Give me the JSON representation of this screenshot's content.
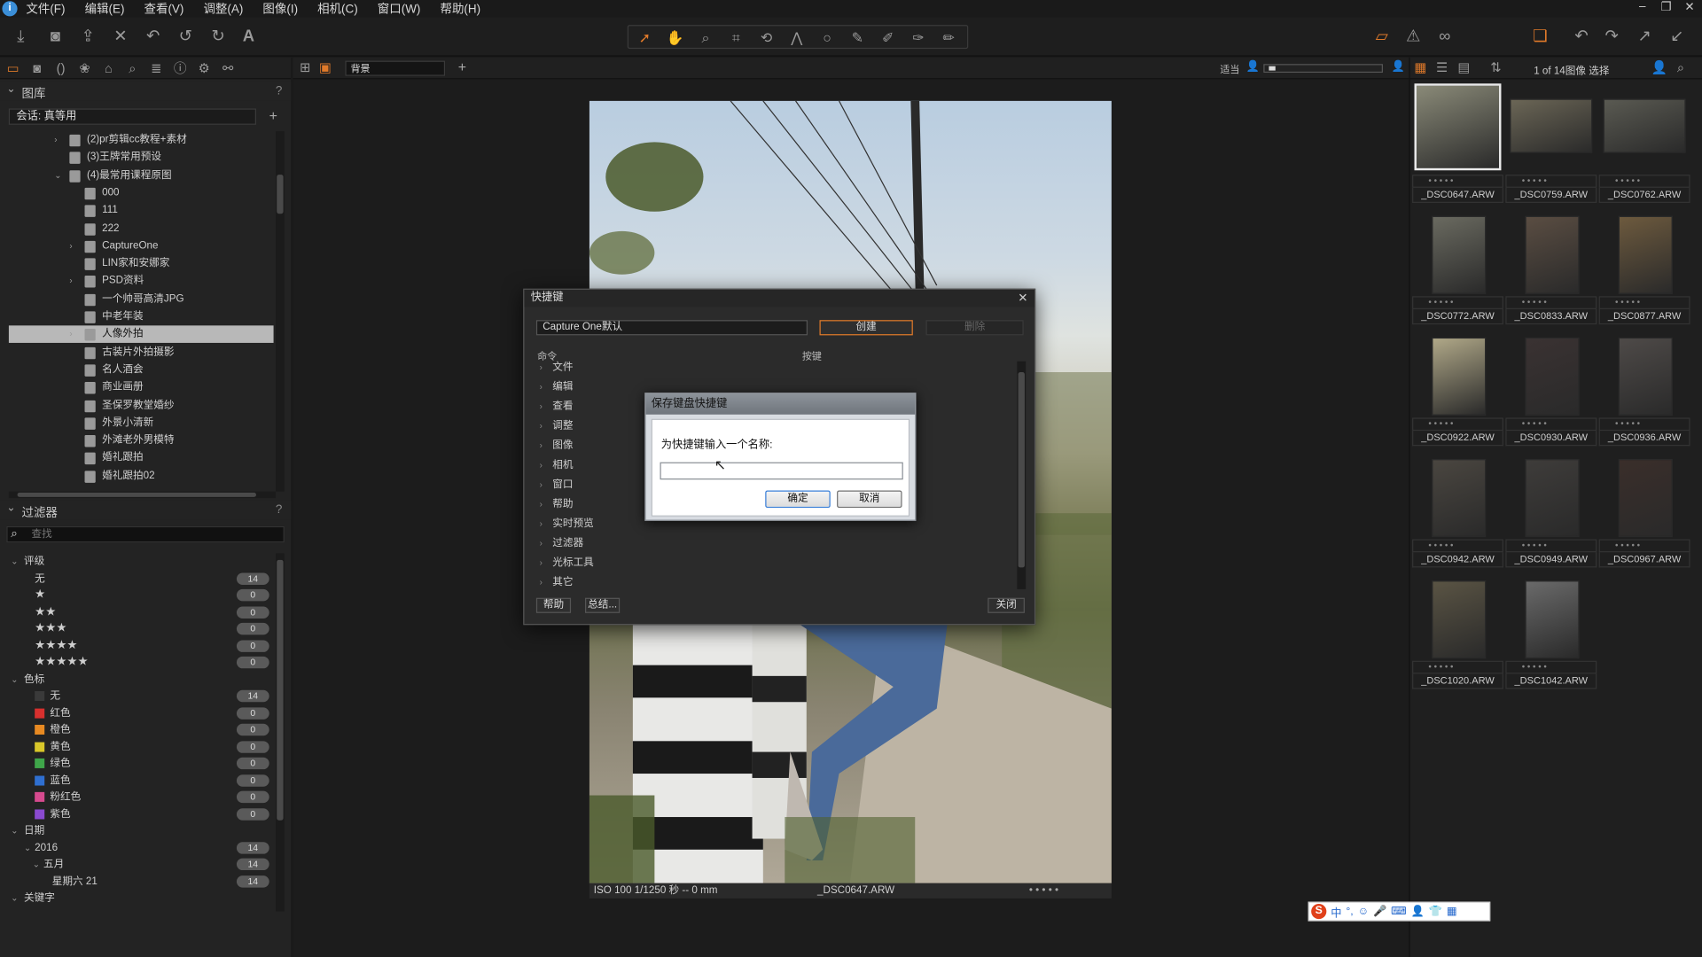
{
  "menu": {
    "items": [
      "文件(F)",
      "编辑(E)",
      "查看(V)",
      "调整(A)",
      "图像(I)",
      "相机(C)",
      "窗口(W)",
      "帮助(H)"
    ]
  },
  "library": {
    "title": "图库",
    "help": "?",
    "catalog": "会话: 真等用",
    "folders": [
      {
        "label": "(2)pr剪辑cc教程+素材",
        "indent": 1,
        "arrow": "›"
      },
      {
        "label": "(3)王牌常用预设",
        "indent": 1,
        "arrow": ""
      },
      {
        "label": "(4)最常用课程原图",
        "indent": 1,
        "arrow": "⌄"
      },
      {
        "label": "000",
        "indent": 2,
        "arrow": ""
      },
      {
        "label": "111",
        "indent": 2,
        "arrow": ""
      },
      {
        "label": "222",
        "indent": 2,
        "arrow": ""
      },
      {
        "label": "CaptureOne",
        "indent": 2,
        "arrow": "›"
      },
      {
        "label": "LIN家和安娜家",
        "indent": 2,
        "arrow": ""
      },
      {
        "label": "PSD资料",
        "indent": 2,
        "arrow": "›"
      },
      {
        "label": "一个帅哥高清JPG",
        "indent": 2,
        "arrow": ""
      },
      {
        "label": "中老年装",
        "indent": 2,
        "arrow": ""
      },
      {
        "label": "人像外拍",
        "indent": 2,
        "arrow": "›",
        "selected": true
      },
      {
        "label": "古装片外拍摄影",
        "indent": 2,
        "arrow": ""
      },
      {
        "label": "名人酒会",
        "indent": 2,
        "arrow": ""
      },
      {
        "label": "商业画册",
        "indent": 2,
        "arrow": ""
      },
      {
        "label": "圣保罗教堂婚纱",
        "indent": 2,
        "arrow": ""
      },
      {
        "label": "外景小清新",
        "indent": 2,
        "arrow": ""
      },
      {
        "label": "外滩老外男模特",
        "indent": 2,
        "arrow": ""
      },
      {
        "label": "婚礼跟拍",
        "indent": 2,
        "arrow": ""
      },
      {
        "label": "婚礼跟拍02",
        "indent": 2,
        "arrow": ""
      }
    ]
  },
  "filters": {
    "title": "过滤器",
    "help": "?",
    "search_placeholder": "查找",
    "rating_title": "评级",
    "ratings": [
      {
        "label": "无",
        "count": "14"
      },
      {
        "label": "★",
        "count": "0"
      },
      {
        "label": "★★",
        "count": "0"
      },
      {
        "label": "★★★",
        "count": "0"
      },
      {
        "label": "★★★★",
        "count": "0"
      },
      {
        "label": "★★★★★",
        "count": "0"
      }
    ],
    "color_title": "色标",
    "colors": [
      {
        "label": "无",
        "count": "14",
        "color": "#3a3a3a"
      },
      {
        "label": "红色",
        "count": "0",
        "color": "#d8302e"
      },
      {
        "label": "橙色",
        "count": "0",
        "color": "#e88a22"
      },
      {
        "label": "黄色",
        "count": "0",
        "color": "#d9c72a"
      },
      {
        "label": "绿色",
        "count": "0",
        "color": "#3fa64a"
      },
      {
        "label": "蓝色",
        "count": "0",
        "color": "#2f6fd0"
      },
      {
        "label": "粉红色",
        "count": "0",
        "color": "#d64a8e"
      },
      {
        "label": "紫色",
        "count": "0",
        "color": "#8a4ad0"
      }
    ],
    "date_title": "日期",
    "dates": [
      {
        "label": "2016",
        "count": "14"
      },
      {
        "label": "五月",
        "count": "14"
      },
      {
        "label": "星期六 21",
        "count": "14"
      }
    ],
    "keyword_title": "关键字"
  },
  "viewer": {
    "layer": "背景",
    "exposure_label": "适当",
    "photo_info": "ISO 100  1/1250 秒  -- 0 mm",
    "photo_name": "_DSC0647.ARW",
    "photo_dots": "• • • • •"
  },
  "browser": {
    "count": "1 of 14图像 选择",
    "thumbs": [
      {
        "name": "_DSC0647.ARW",
        "selected": true,
        "tone": "#8a8a78"
      },
      {
        "name": "_DSC0759.ARW",
        "tone": "#6b6656"
      },
      {
        "name": "_DSC0762.ARW",
        "tone": "#5a5a52"
      },
      {
        "name": "_DSC0772.ARW",
        "tone": "#6a6a60"
      },
      {
        "name": "_DSC0833.ARW",
        "tone": "#5a4d42"
      },
      {
        "name": "_DSC0877.ARW",
        "tone": "#6d5a3e"
      },
      {
        "name": "_DSC0922.ARW",
        "tone": "#b0a888"
      },
      {
        "name": "_DSC0930.ARW",
        "tone": "#3a3232"
      },
      {
        "name": "_DSC0936.ARW",
        "tone": "#4e4a48"
      },
      {
        "name": "_DSC0942.ARW",
        "tone": "#4a4640"
      },
      {
        "name": "_DSC0949.ARW",
        "tone": "#3e3c3a"
      },
      {
        "name": "_DSC0967.ARW",
        "tone": "#3a2e2a"
      },
      {
        "name": "_DSC1020.ARW",
        "tone": "#5a5444"
      },
      {
        "name": "_DSC1042.ARW",
        "tone": "#6a6a6a"
      }
    ]
  },
  "shortcut_dialog": {
    "title": "快捷键",
    "preset": "Capture One默认",
    "create": "创建",
    "delete": "删除",
    "col_command": "命令",
    "col_key": "按键",
    "commands": [
      "文件",
      "编辑",
      "查看",
      "调整",
      "图像",
      "相机",
      "窗口",
      "帮助",
      "实时预览",
      "过滤器",
      "光标工具",
      "其它"
    ],
    "help": "帮助",
    "summary": "总结...",
    "close": "关闭"
  },
  "save_dialog": {
    "title": "保存键盘快捷键",
    "prompt": "为快捷键输入一个名称:",
    "input_value": "",
    "ok": "确定",
    "cancel": "取消"
  },
  "ime": {
    "label": "中"
  }
}
